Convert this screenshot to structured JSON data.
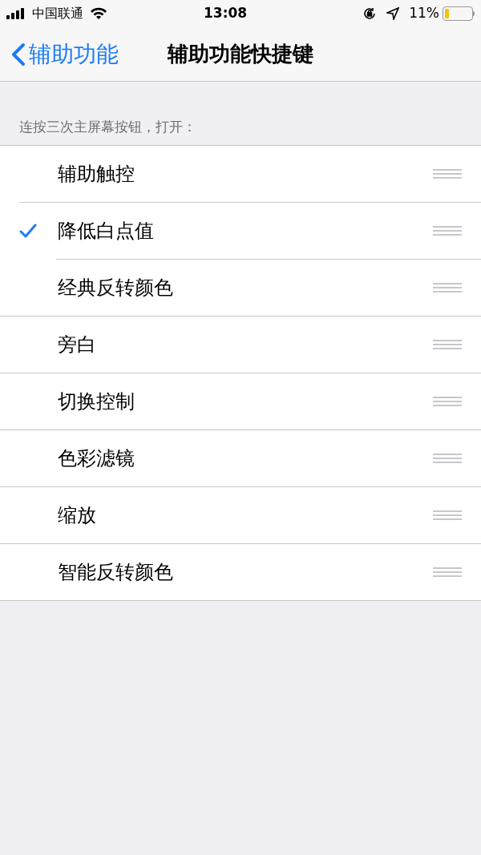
{
  "status_bar": {
    "carrier": "中国联通",
    "time": "13:08",
    "battery": "11%"
  },
  "nav": {
    "back": "辅助功能",
    "title": "辅助功能快捷键"
  },
  "section_header": "连按三次主屏幕按钮，打开：",
  "items": [
    {
      "label": "辅助触控",
      "selected": false
    },
    {
      "label": "降低白点值",
      "selected": true
    },
    {
      "label": "经典反转颜色",
      "selected": false
    },
    {
      "label": "旁白",
      "selected": false
    },
    {
      "label": "切换控制",
      "selected": false
    },
    {
      "label": "色彩滤镜",
      "selected": false
    },
    {
      "label": "缩放",
      "selected": false
    },
    {
      "label": "智能反转颜色",
      "selected": false
    }
  ]
}
